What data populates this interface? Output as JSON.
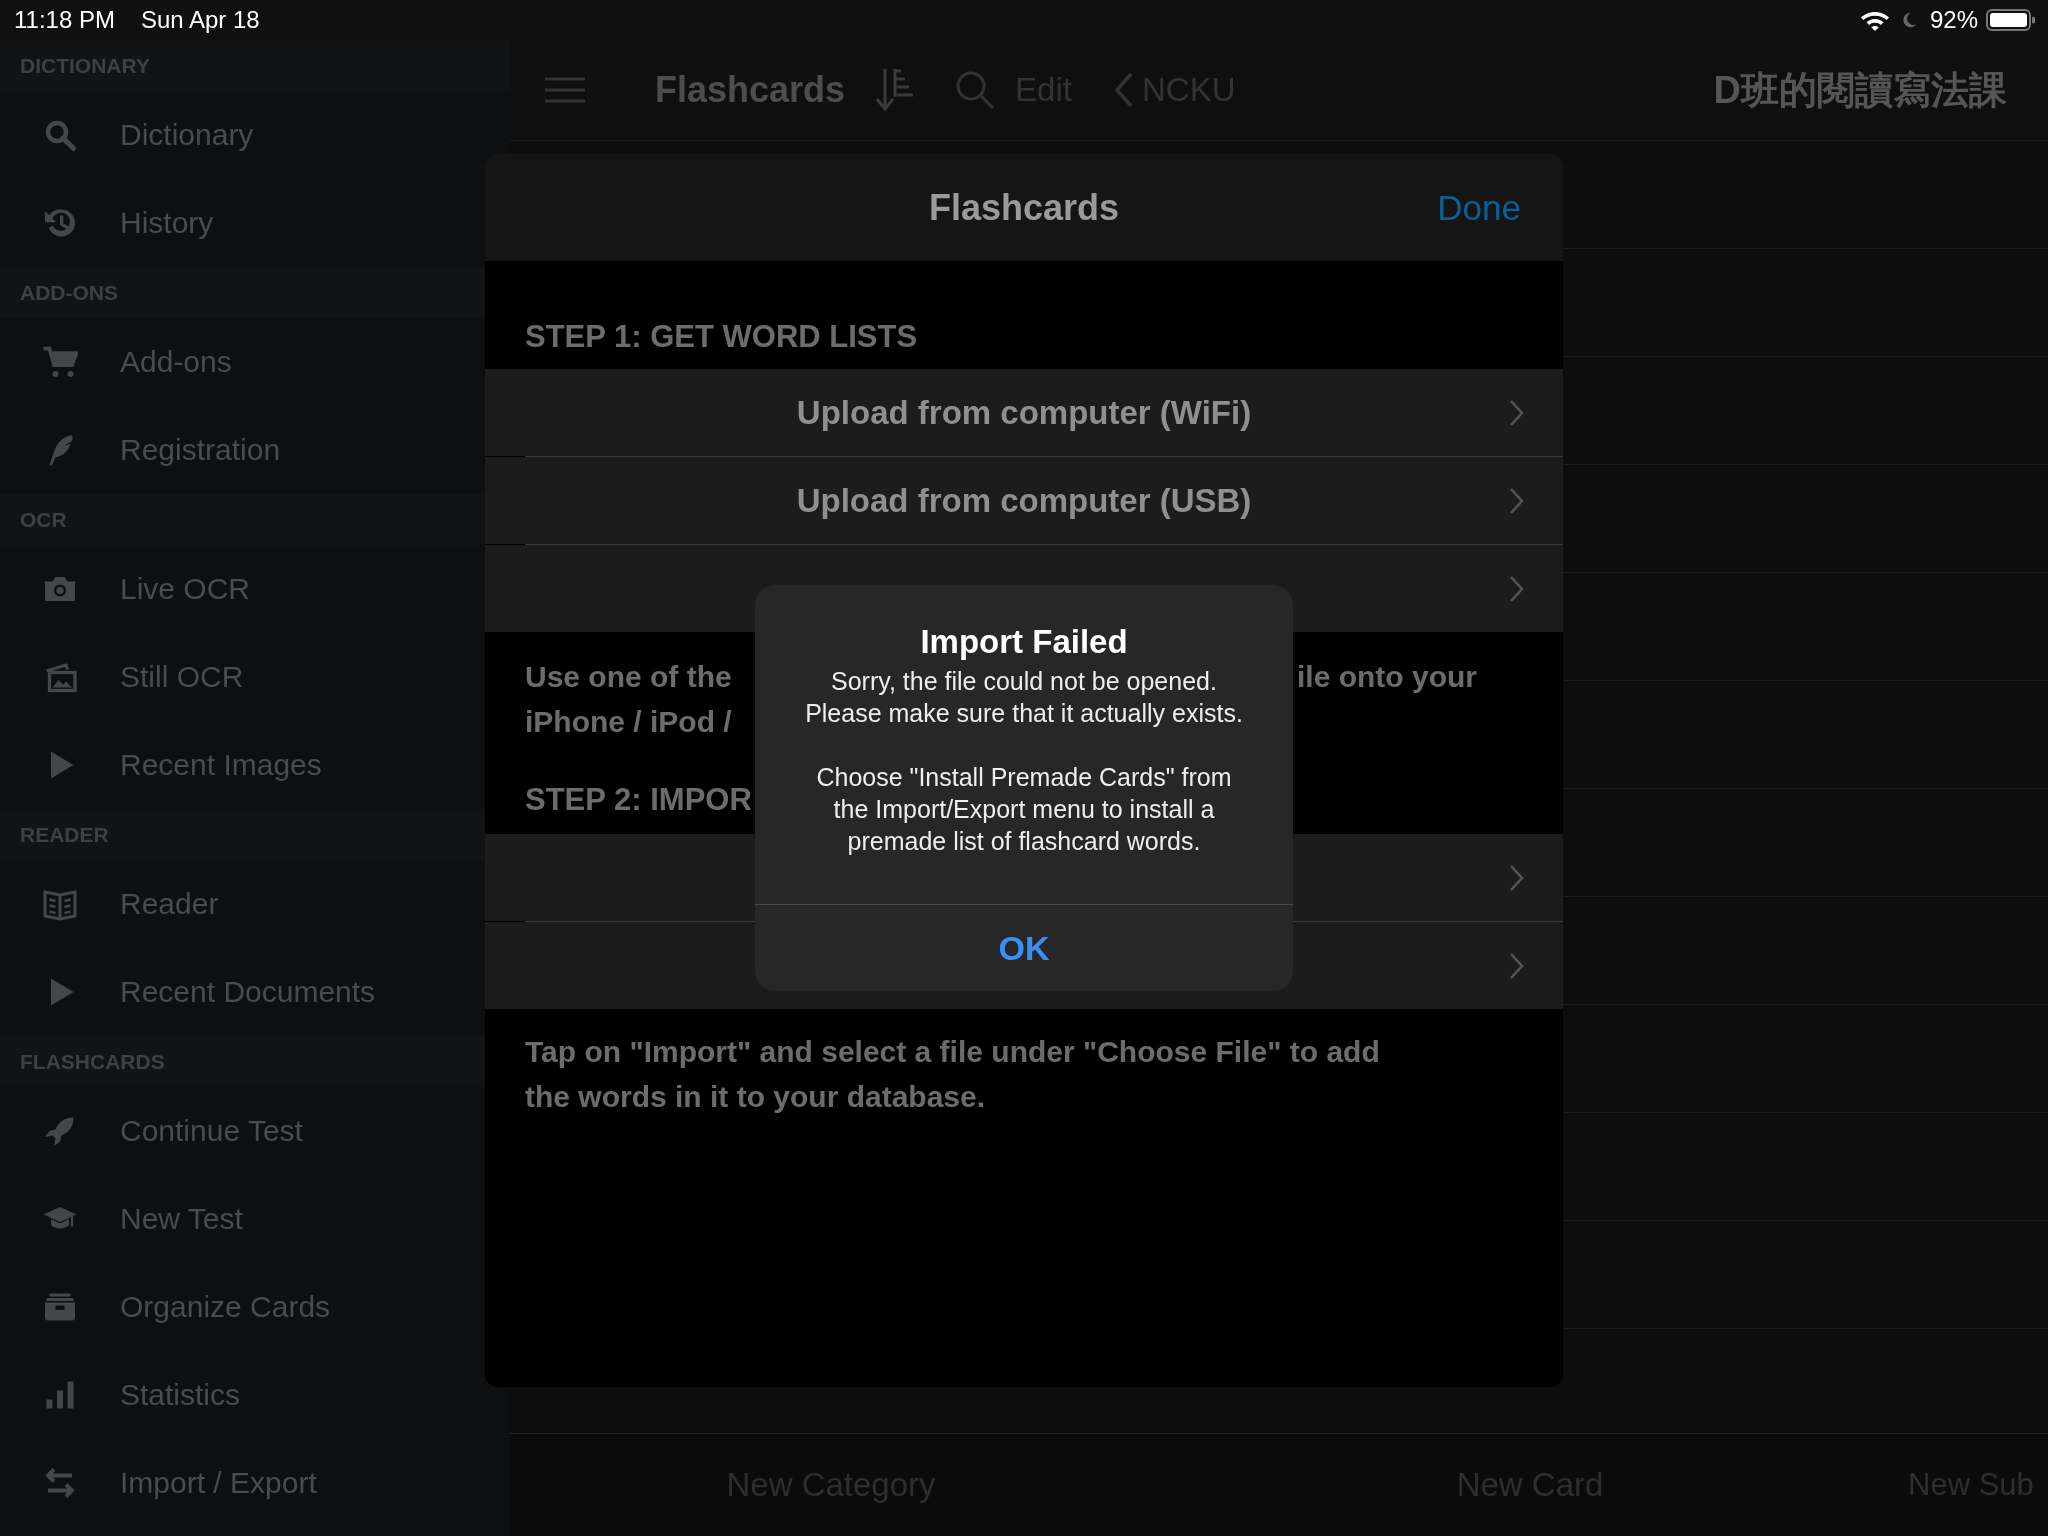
{
  "status_bar": {
    "time": "11:18 PM",
    "date": "Sun Apr 18",
    "battery": "92%"
  },
  "sidebar": {
    "sections": [
      {
        "title": "DICTIONARY",
        "items": [
          {
            "label": "Dictionary"
          },
          {
            "label": "History"
          }
        ]
      },
      {
        "title": "ADD-ONS",
        "items": [
          {
            "label": "Add-ons"
          },
          {
            "label": "Registration"
          }
        ]
      },
      {
        "title": "OCR",
        "items": [
          {
            "label": "Live OCR"
          },
          {
            "label": "Still OCR"
          },
          {
            "label": "Recent Images"
          }
        ]
      },
      {
        "title": "READER",
        "items": [
          {
            "label": "Reader"
          },
          {
            "label": "Recent Documents"
          }
        ]
      },
      {
        "title": "FLASHCARDS",
        "items": [
          {
            "label": "Continue Test"
          },
          {
            "label": "New Test"
          },
          {
            "label": "Organize Cards"
          },
          {
            "label": "Statistics"
          },
          {
            "label": "Import / Export"
          }
        ]
      }
    ]
  },
  "nav_bar": {
    "heading": "Flashcards",
    "edit": "Edit",
    "back": "NCKU",
    "title": "D班的閱讀寫法課"
  },
  "toolbar": {
    "buttons": [
      "New Category",
      "New Card",
      "New Sub"
    ]
  },
  "sheet": {
    "title": "Flashcards",
    "done": "Done",
    "groups": [
      {
        "header": "STEP 1: GET WORD LISTS",
        "rows": [
          {
            "kind": "label",
            "label": "Upload from computer (WiFi)"
          },
          {
            "kind": "label",
            "label": "Upload from computer (USB)"
          },
          {
            "kind": "covered"
          }
        ],
        "footer_left": "Use one of the\niPhone / iPod /",
        "footer_right": "ile onto your"
      },
      {
        "header": "STEP 2: IMPOR",
        "rows": [
          {
            "kind": "covered"
          },
          {
            "kind": "covered"
          }
        ],
        "footer_left": "Tap on \"Import\" and select a file under \"Choose File\" to add\nthe words in it to your database."
      }
    ]
  },
  "alert": {
    "title": "Import Failed",
    "paragraphs": [
      "Sorry, the file could not be opened.\nPlease make sure that it actually exists.",
      "Choose \"Install Premade Cards\" from\nthe Import/Export menu to install a\npremade list of flashcard words."
    ],
    "button": "OK"
  }
}
